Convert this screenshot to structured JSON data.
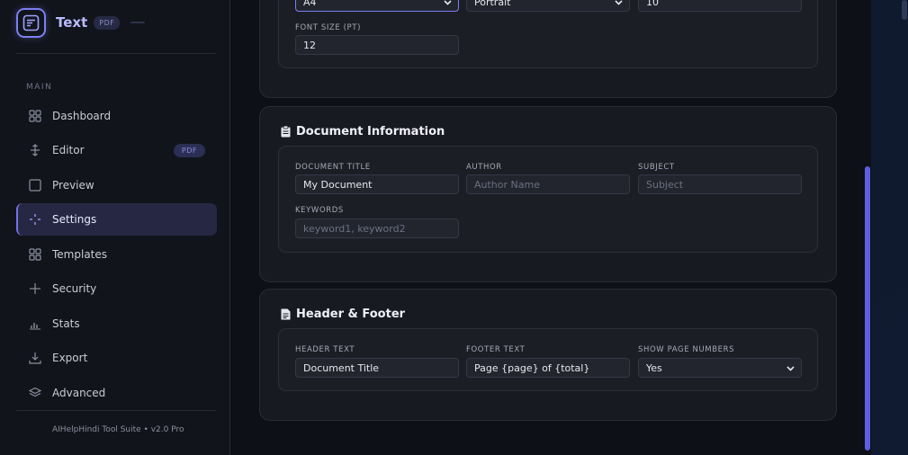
{
  "brand": {
    "title": "Text",
    "badge": "PDF"
  },
  "nav": {
    "section": "MAIN",
    "items": [
      {
        "label": "Dashboard",
        "icon": "grid-icon"
      },
      {
        "label": "Editor",
        "icon": "move-icon",
        "badge": "PDF"
      },
      {
        "label": "Preview",
        "icon": "square-icon"
      },
      {
        "label": "Settings",
        "icon": "sparkle-icon",
        "active": true
      },
      {
        "label": "Templates",
        "icon": "grid-icon"
      },
      {
        "label": "Security",
        "icon": "plus-icon"
      },
      {
        "label": "Stats",
        "icon": "bar-chart-icon"
      },
      {
        "label": "Export",
        "icon": "download-icon"
      },
      {
        "label": "Advanced",
        "icon": "layers-icon"
      }
    ],
    "footer": "AIHelpHindi Tool Suite • v2.0 Pro"
  },
  "page_settings": {
    "page_size": "A4",
    "orientation": "Portrait",
    "margin": "10",
    "font_size_label": "FONT SIZE (PT)",
    "font_size": "12"
  },
  "doc_info": {
    "title": "Document Information",
    "title_label": "DOCUMENT TITLE",
    "title_value": "My Document",
    "author_label": "AUTHOR",
    "author_placeholder": "Author Name",
    "subject_label": "SUBJECT",
    "subject_placeholder": "Subject",
    "keywords_label": "KEYWORDS",
    "keywords_placeholder": "keyword1, keyword2"
  },
  "header_footer": {
    "title": "Header & Footer",
    "header_label": "HEADER TEXT",
    "header_value": "Document Title",
    "footer_label": "FOOTER TEXT",
    "footer_value": "Page {page} of {total}",
    "page_numbers_label": "SHOW PAGE NUMBERS",
    "page_numbers_value": "Yes"
  },
  "colors": {
    "accent": "#6f72e8",
    "background": "#0e1017",
    "card": "#181a21"
  }
}
